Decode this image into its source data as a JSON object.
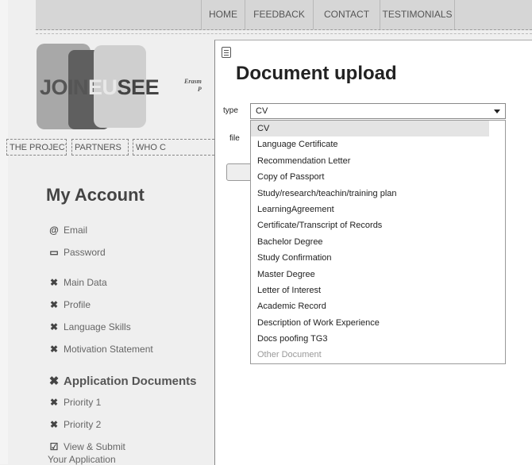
{
  "nav": {
    "items": [
      "HOME",
      "FEEDBACK",
      "CONTACT",
      "TESTIMONIALS"
    ]
  },
  "logo": {
    "part1": "JOIN",
    "part2": "EU",
    "part3": "SEE",
    "erasmus_line1": "Erasm",
    "erasmus_line2": "P"
  },
  "subnav": {
    "items": [
      "THE PROJECT",
      "PARTNERS",
      "WHO C"
    ]
  },
  "sidebar": {
    "title": "My Account",
    "email": "Email",
    "password": "Password",
    "main_data": "Main Data",
    "profile": "Profile",
    "language_skills": "Language Skills",
    "motivation": "Motivation Statement",
    "app_docs": "Application Documents",
    "priority1": "Priority 1",
    "priority2": "Priority 2",
    "view_submit": "View & Submit",
    "your_application": "Your Application"
  },
  "modal": {
    "title": "Document upload",
    "type_label": "type",
    "file_label": "file",
    "selected_type": "CV",
    "options": [
      "CV",
      "Language Certificate",
      "Recommendation Letter",
      "Copy of Passport",
      "Study/research/teachin/training plan",
      "LearningAgreement",
      "Certificate/Transcript of Records",
      "Bachelor Degree",
      "Study Confirmation",
      "Master Degree",
      "Letter of Interest",
      "Academic Record",
      "Description of Work Experience",
      "Docs poofing TG3",
      "Other Document"
    ]
  }
}
